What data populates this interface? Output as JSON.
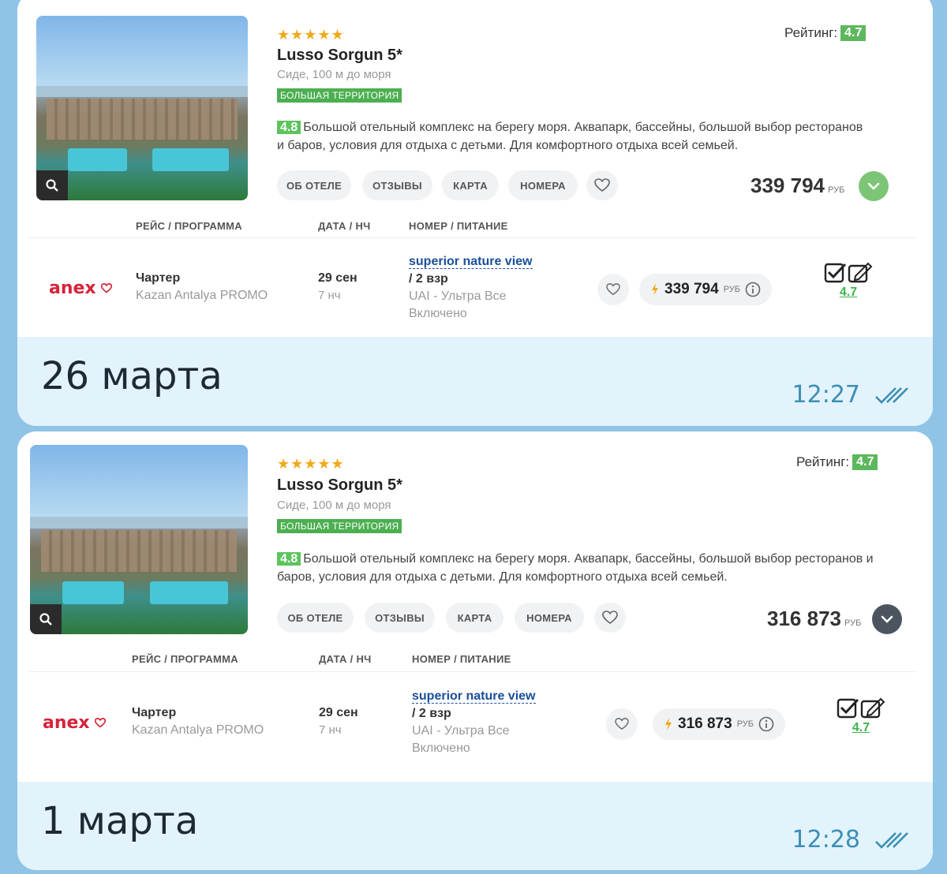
{
  "messages": [
    {
      "hotel": {
        "stars": "★★★★★",
        "name": "Lusso Sorgun 5*",
        "location": "Сиде, 100 м до моря",
        "tag": "БОЛЬШАЯ ТЕРРИТОРИЯ",
        "rating_label": "Рейтинг:",
        "rating_value": "4.7",
        "desc_score": "4.8",
        "description": "Большой отельный комплекс на берегу моря. Аквапарк, бассейны, большой выбор ресторанов и баров, условия для отдыха с детьми. Для комфортного отдыха всей семьей.",
        "buttons": [
          "ОБ ОТЕЛЕ",
          "ОТЗЫВЫ",
          "КАРТА",
          "НОМЕРА"
        ],
        "price": "339 794",
        "currency": "РУБ",
        "toggle_color": "#7cc576"
      },
      "table": {
        "headers": [
          "РЕЙС / ПРОГРАММА",
          "ДАТА / НЧ",
          "НОМЕР / ПИТАНИЕ"
        ],
        "operator": "anex",
        "flight_type": "Чартер",
        "program": "Kazan Antalya PROMO",
        "date": "29 сен",
        "nights": "7 нч",
        "room": "superior nature view",
        "people": "/ 2 взр",
        "meal": "UAI - Ультра Все Включено",
        "offer_price": "339 794",
        "offer_currency": "РУБ",
        "rating_link": "4.7"
      },
      "footer": {
        "date": "26 марта",
        "time": "12:27"
      }
    },
    {
      "hotel": {
        "stars": "★★★★★",
        "name": "Lusso Sorgun 5*",
        "location": "Сиде, 100 м до моря",
        "tag": "БОЛЬШАЯ ТЕРРИТОРИЯ",
        "rating_label": "Рейтинг:",
        "rating_value": "4.7",
        "desc_score": "4.8",
        "description": "Большой отельный комплекс на берегу моря. Аквапарк, бассейны, большой выбор ресторанов и баров, условия для отдыха с детьми. Для комфортного отдыха всей семьей.",
        "buttons": [
          "ОБ ОТЕЛЕ",
          "ОТЗЫВЫ",
          "КАРТА",
          "НОМЕРА"
        ],
        "price": "316 873",
        "currency": "РУБ",
        "toggle_color": "#4a5560"
      },
      "table": {
        "headers": [
          "РЕЙС / ПРОГРАММА",
          "ДАТА / НЧ",
          "НОМЕР / ПИТАНИЕ"
        ],
        "operator": "anex",
        "flight_type": "Чартер",
        "program": "Kazan Antalya PROMO",
        "date": "29 сен",
        "nights": "7 нч",
        "room": "superior nature view",
        "people": "/ 2 взр",
        "meal": "UAI - Ультра Все Включено",
        "offer_price": "316 873",
        "offer_currency": "РУБ",
        "rating_link": "4.7"
      },
      "footer": {
        "date": "1 марта",
        "time": "12:28"
      }
    }
  ]
}
